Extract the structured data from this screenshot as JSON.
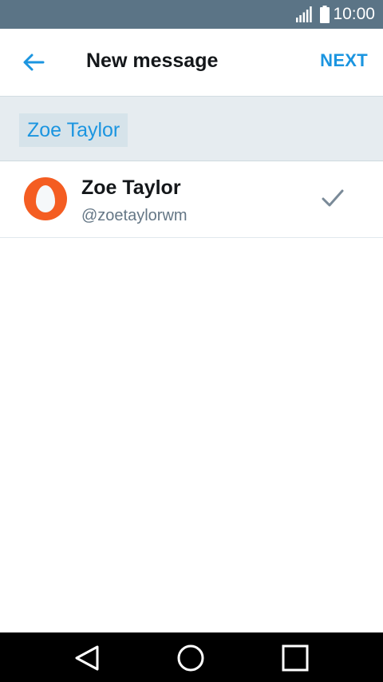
{
  "status_bar": {
    "time": "10:00",
    "icons": [
      "signal-icon",
      "battery-icon"
    ]
  },
  "header": {
    "back_icon": "arrow-left-icon",
    "title": "New message",
    "next_label": "NEXT"
  },
  "recipients": [
    {
      "name": "Zoe Taylor"
    }
  ],
  "results": [
    {
      "name": "Zoe Taylor",
      "handle": "@zoetaylorwm",
      "avatar_icon": "egg-avatar-icon",
      "selected": true,
      "selected_icon": "checkmark-icon"
    }
  ],
  "nav_bar": {
    "icons": [
      "nav-back-icon",
      "nav-home-icon",
      "nav-recents-icon"
    ]
  },
  "colors": {
    "status_bar": "#5b7486",
    "accent": "#1b95e0",
    "recipient_bar": "#e6ecf0",
    "avatar": "#f45d22",
    "check": "#7a8a98"
  }
}
